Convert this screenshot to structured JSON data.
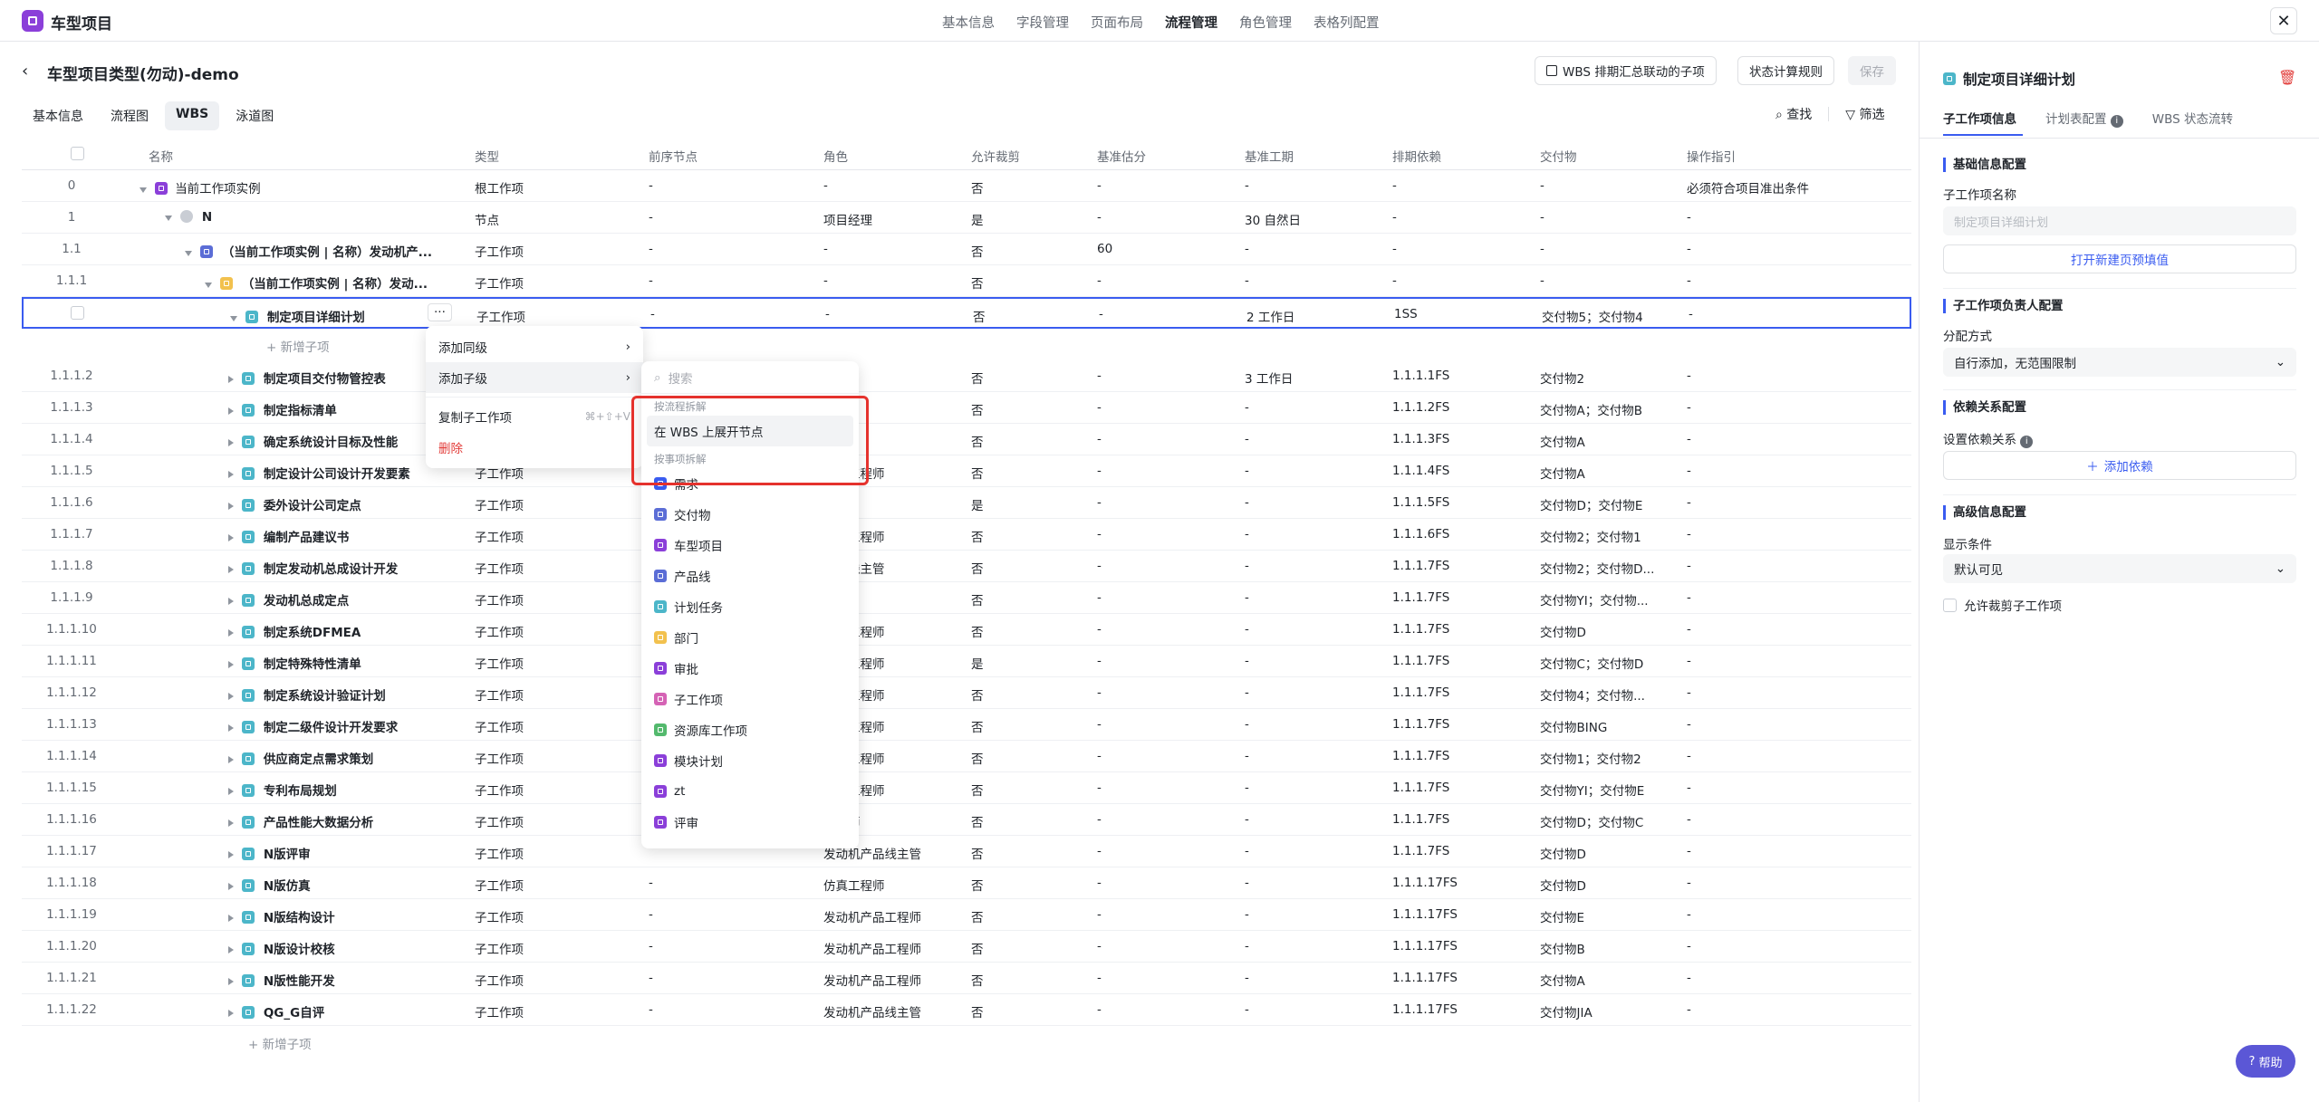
{
  "app": {
    "title": "车型项目"
  },
  "topnav": [
    "基本信息",
    "字段管理",
    "页面布局",
    "流程管理",
    "角色管理",
    "表格列配置"
  ],
  "topnav_active": 3,
  "page": {
    "title": "车型项目类型(勿动)-demo",
    "btn_wbs": "WBS 排期汇总联动的子项",
    "btn_status": "状态计算规则",
    "btn_save": "保存"
  },
  "tabs": [
    "基本信息",
    "流程图",
    "WBS",
    "泳道图"
  ],
  "tabs_active": 2,
  "tools": {
    "find": "查找",
    "filter": "筛选"
  },
  "columns": [
    "名称",
    "类型",
    "前序节点",
    "角色",
    "允许裁剪",
    "基准估分",
    "基准工期",
    "排期依赖",
    "交付物",
    "操作指引"
  ],
  "rows": [
    {
      "no": "0",
      "name": "当前工作项实例",
      "type": "根工作项",
      "prev": "-",
      "role": "-",
      "cut": "否",
      "est": "-",
      "dur": "-",
      "dep": "-",
      "deliv": "-",
      "guide": "必须符合项目准出条件",
      "level": 0,
      "icon": "purple",
      "expand": "down",
      "bold": false
    },
    {
      "no": "1",
      "name": "N",
      "type": "节点",
      "prev": "-",
      "role": "项目经理",
      "cut": "是",
      "est": "-",
      "dur": "30 自然日",
      "dep": "-",
      "deliv": "-",
      "guide": "-",
      "level": 1,
      "icon": "grey",
      "expand": "down",
      "bold": true
    },
    {
      "no": "1.1",
      "name": "（当前工作项实例 | 名称）发动机产...",
      "type": "子工作项",
      "prev": "-",
      "role": "-",
      "cut": "否",
      "est": "60",
      "dur": "-",
      "dep": "-",
      "deliv": "-",
      "guide": "-",
      "level": 2,
      "icon": "indigo",
      "expand": "down",
      "bold": true
    },
    {
      "no": "1.1.1",
      "name": "（当前工作项实例 | 名称）发动...",
      "type": "子工作项",
      "prev": "-",
      "role": "-",
      "cut": "否",
      "est": "-",
      "dur": "-",
      "dep": "-",
      "deliv": "-",
      "guide": "-",
      "level": 3,
      "icon": "yellow",
      "expand": "down",
      "bold": true
    },
    {
      "no": "",
      "name": "制定项目详细计划",
      "type": "子工作项",
      "prev": "-",
      "role": "-",
      "cut": "否",
      "est": "-",
      "dur": "2 工作日",
      "dep": "1SS",
      "deliv": "交付物5；交付物4",
      "guide": "-",
      "level": 4,
      "icon": "teal",
      "expand": "down",
      "bold": true,
      "selected": true
    },
    {
      "add": true,
      "label": "新增子项"
    },
    {
      "no": "1.1.1.2",
      "name": "制定项目交付物管控表",
      "type": "子工作项",
      "prev": "",
      "role": "",
      "cut": "否",
      "est": "-",
      "dur": "3 工作日",
      "dep": "1.1.1.1FS",
      "deliv": "交付物2",
      "guide": "-",
      "level": 4,
      "icon": "teal",
      "expand": "right",
      "bold": true
    },
    {
      "no": "1.1.1.3",
      "name": "制定指标清单",
      "type": "",
      "prev": "",
      "role": "",
      "cut": "否",
      "est": "-",
      "dur": "-",
      "dep": "1.1.1.2FS",
      "deliv": "交付物A；交付物B",
      "guide": "-",
      "level": 4,
      "icon": "teal",
      "expand": "right",
      "bold": true
    },
    {
      "no": "1.1.1.4",
      "name": "确定系统设计目标及性能",
      "type": "",
      "prev": "",
      "role": "",
      "cut": "否",
      "est": "-",
      "dur": "-",
      "dep": "1.1.1.3FS",
      "deliv": "交付物A",
      "guide": "-",
      "level": 4,
      "icon": "teal",
      "expand": "right",
      "bold": true
    },
    {
      "no": "1.1.1.5",
      "name": "制定设计公司设计开发要素",
      "type": "子工作项",
      "prev": "",
      "role": "产品工程师",
      "cut": "否",
      "est": "-",
      "dur": "-",
      "dep": "1.1.1.4FS",
      "deliv": "交付物A",
      "guide": "-",
      "level": 4,
      "icon": "teal",
      "expand": "right",
      "bold": true
    },
    {
      "no": "1.1.1.6",
      "name": "委外设计公司定点",
      "type": "子工作项",
      "prev": "",
      "role": "经理",
      "cut": "是",
      "est": "-",
      "dur": "-",
      "dep": "1.1.1.5FS",
      "deliv": "交付物D；交付物E",
      "guide": "-",
      "level": 4,
      "icon": "teal",
      "expand": "right",
      "bold": true
    },
    {
      "no": "1.1.1.7",
      "name": "编制产品建议书",
      "type": "子工作项",
      "prev": "",
      "role": "产品工程师",
      "cut": "否",
      "est": "-",
      "dur": "-",
      "dep": "1.1.1.6FS",
      "deliv": "交付物2；交付物1",
      "guide": "-",
      "level": 4,
      "icon": "teal",
      "expand": "right",
      "bold": true
    },
    {
      "no": "1.1.1.8",
      "name": "制定发动机总成设计开发",
      "type": "子工作项",
      "prev": "",
      "role": "产品线主管",
      "cut": "否",
      "est": "-",
      "dur": "-",
      "dep": "1.1.1.7FS",
      "deliv": "交付物2；交付物D...",
      "guide": "-",
      "level": 4,
      "icon": "teal",
      "expand": "right",
      "bold": true
    },
    {
      "no": "1.1.1.9",
      "name": "发动机总成定点",
      "type": "子工作项",
      "prev": "",
      "role": "经理",
      "cut": "否",
      "est": "-",
      "dur": "-",
      "dep": "1.1.1.7FS",
      "deliv": "交付物YI；交付物...",
      "guide": "-",
      "level": 4,
      "icon": "teal",
      "expand": "right",
      "bold": true
    },
    {
      "no": "1.1.1.10",
      "name": "制定系统DFMEA",
      "type": "子工作项",
      "prev": "",
      "role": "产品工程师",
      "cut": "否",
      "est": "-",
      "dur": "-",
      "dep": "1.1.1.7FS",
      "deliv": "交付物D",
      "guide": "-",
      "level": 4,
      "icon": "teal",
      "expand": "right",
      "bold": true
    },
    {
      "no": "1.1.1.11",
      "name": "制定特殊特性清单",
      "type": "子工作项",
      "prev": "",
      "role": "产品工程师",
      "cut": "是",
      "est": "-",
      "dur": "-",
      "dep": "1.1.1.7FS",
      "deliv": "交付物C；交付物D",
      "guide": "-",
      "level": 4,
      "icon": "teal",
      "expand": "right",
      "bold": true
    },
    {
      "no": "1.1.1.12",
      "name": "制定系统设计验证计划",
      "type": "子工作项",
      "prev": "",
      "role": "产品工程师",
      "cut": "否",
      "est": "-",
      "dur": "-",
      "dep": "1.1.1.7FS",
      "deliv": "交付物4；交付物...",
      "guide": "-",
      "level": 4,
      "icon": "teal",
      "expand": "right",
      "bold": true
    },
    {
      "no": "1.1.1.13",
      "name": "制定二级件设计开发要求",
      "type": "子工作项",
      "prev": "",
      "role": "产品工程师",
      "cut": "否",
      "est": "-",
      "dur": "-",
      "dep": "1.1.1.7FS",
      "deliv": "交付物BING",
      "guide": "-",
      "level": 4,
      "icon": "teal",
      "expand": "right",
      "bold": true
    },
    {
      "no": "1.1.1.14",
      "name": "供应商定点需求策划",
      "type": "子工作项",
      "prev": "",
      "role": "产品工程师",
      "cut": "否",
      "est": "-",
      "dur": "-",
      "dep": "1.1.1.7FS",
      "deliv": "交付物1；交付物2",
      "guide": "-",
      "level": 4,
      "icon": "teal",
      "expand": "right",
      "bold": true
    },
    {
      "no": "1.1.1.15",
      "name": "专利布局规划",
      "type": "子工作项",
      "prev": "",
      "role": "产品工程师",
      "cut": "否",
      "est": "-",
      "dur": "-",
      "dep": "1.1.1.7FS",
      "deliv": "交付物YI；交付物E",
      "guide": "-",
      "level": 4,
      "icon": "teal",
      "expand": "right",
      "bold": true
    },
    {
      "no": "1.1.1.16",
      "name": "产品性能大数据分析",
      "type": "子工作项",
      "prev": "",
      "role": "工程师",
      "cut": "否",
      "est": "-",
      "dur": "-",
      "dep": "1.1.1.7FS",
      "deliv": "交付物D；交付物C",
      "guide": "-",
      "level": 4,
      "icon": "teal",
      "expand": "right",
      "bold": true
    },
    {
      "no": "1.1.1.17",
      "name": "N版评审",
      "type": "子工作项",
      "prev": "",
      "role": "发动机产品线主管",
      "cut": "否",
      "est": "-",
      "dur": "-",
      "dep": "1.1.1.7FS",
      "deliv": "交付物D",
      "guide": "-",
      "level": 4,
      "icon": "teal",
      "expand": "right",
      "bold": true
    },
    {
      "no": "1.1.1.18",
      "name": "N版仿真",
      "type": "子工作项",
      "prev": "-",
      "role": "仿真工程师",
      "cut": "否",
      "est": "-",
      "dur": "-",
      "dep": "1.1.1.17FS",
      "deliv": "交付物D",
      "guide": "-",
      "level": 4,
      "icon": "teal",
      "expand": "right",
      "bold": true
    },
    {
      "no": "1.1.1.19",
      "name": "N版结构设计",
      "type": "子工作项",
      "prev": "-",
      "role": "发动机产品工程师",
      "cut": "否",
      "est": "-",
      "dur": "-",
      "dep": "1.1.1.17FS",
      "deliv": "交付物E",
      "guide": "-",
      "level": 4,
      "icon": "teal",
      "expand": "right",
      "bold": true
    },
    {
      "no": "1.1.1.20",
      "name": "N版设计校核",
      "type": "子工作项",
      "prev": "-",
      "role": "发动机产品工程师",
      "cut": "否",
      "est": "-",
      "dur": "-",
      "dep": "1.1.1.17FS",
      "deliv": "交付物B",
      "guide": "-",
      "level": 4,
      "icon": "teal",
      "expand": "right",
      "bold": true
    },
    {
      "no": "1.1.1.21",
      "name": "N版性能开发",
      "type": "子工作项",
      "prev": "-",
      "role": "发动机产品工程师",
      "cut": "否",
      "est": "-",
      "dur": "-",
      "dep": "1.1.1.17FS",
      "deliv": "交付物A",
      "guide": "-",
      "level": 4,
      "icon": "teal",
      "expand": "right",
      "bold": true
    },
    {
      "no": "1.1.1.22",
      "name": "QG_G自评",
      "type": "子工作项",
      "prev": "-",
      "role": "发动机产品线主管",
      "cut": "否",
      "est": "-",
      "dur": "-",
      "dep": "1.1.1.17FS",
      "deliv": "交付物JIA",
      "guide": "-",
      "level": 4,
      "icon": "teal",
      "expand": "right",
      "bold": true
    },
    {
      "add": true,
      "label": "新增子项"
    }
  ],
  "context_menu": {
    "items": [
      "添加同级",
      "添加子级",
      "复制子工作项",
      "删除"
    ],
    "copy_shortcut": "⌘+⇧+V"
  },
  "submenu": {
    "search_placeholder": "搜索",
    "group1": "按流程拆解",
    "group1_item": "在 WBS 上展开节点",
    "group2": "按事项拆解",
    "items": [
      {
        "label": "需求",
        "icon": "blue"
      },
      {
        "label": "交付物",
        "icon": "indigo"
      },
      {
        "label": "车型项目",
        "icon": "purple"
      },
      {
        "label": "产品线",
        "icon": "indigo"
      },
      {
        "label": "计划任务",
        "icon": "teal"
      },
      {
        "label": "部门",
        "icon": "yellow"
      },
      {
        "label": "审批",
        "icon": "purple"
      },
      {
        "label": "子工作项",
        "icon": "pink"
      },
      {
        "label": "资源库工作项",
        "icon": "green"
      },
      {
        "label": "模块计划",
        "icon": "purple"
      },
      {
        "label": "zt",
        "icon": "purple"
      },
      {
        "label": "评审",
        "icon": "purple"
      }
    ]
  },
  "panel": {
    "title": "制定项目详细计划",
    "tabs": [
      "子工作项信息",
      "计划表配置",
      "WBS 状态流转"
    ],
    "sec_basic": "基础信息配置",
    "name_label": "子工作项名称",
    "name_placeholder": "制定项目详细计划",
    "open_btn": "打开新建页预填值",
    "sec_owner": "子工作项负责人配置",
    "assign_label": "分配方式",
    "assign_value": "自行添加，无范围限制",
    "sec_dep": "依赖关系配置",
    "dep_label": "设置依赖关系",
    "add_dep": "添加依赖",
    "sec_adv": "高级信息配置",
    "show_label": "显示条件",
    "show_value": "默认可见",
    "allow_cut": "允许裁剪子工作项"
  },
  "help": "帮助"
}
